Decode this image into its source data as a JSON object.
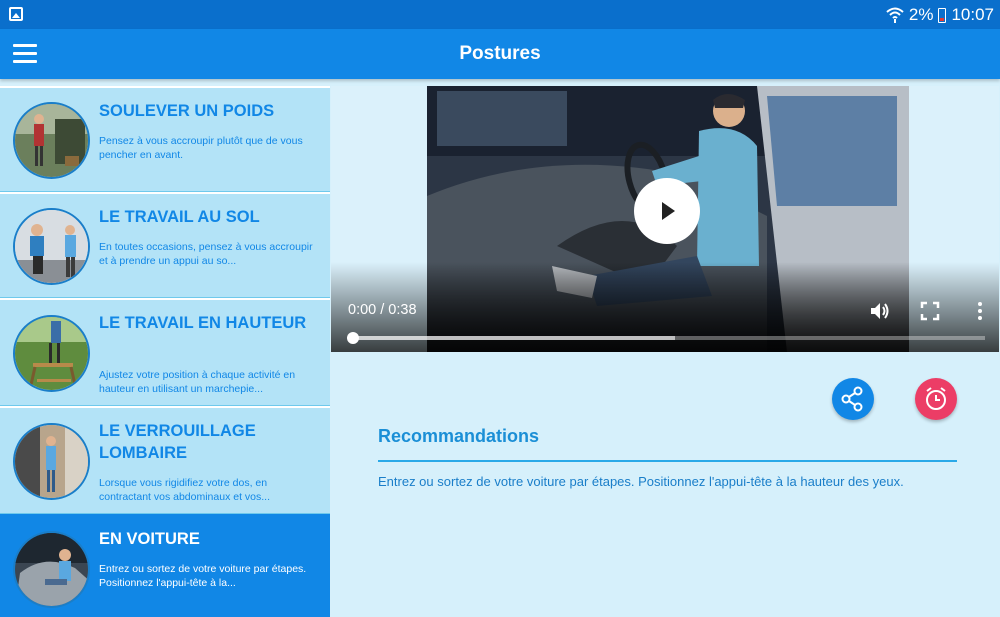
{
  "status_bar": {
    "battery_text": "2%",
    "time": "10:07",
    "icons": [
      "gallery-icon",
      "wifi-icon",
      "battery-icon"
    ]
  },
  "app_bar": {
    "title": "Postures",
    "menu_icon": "hamburger-menu-icon"
  },
  "sidebar": {
    "items": [
      {
        "title": "SOULEVER UN POIDS",
        "desc": "Pensez à vous accroupir plutôt que de vous pencher en avant.",
        "active": false
      },
      {
        "title": "LE TRAVAIL AU SOL",
        "desc": "En toutes occasions, pensez à vous accroupir et à prendre un appui au so...",
        "active": false
      },
      {
        "title": "LE TRAVAIL EN HAUTEUR",
        "desc": "Ajustez votre position à chaque activité en hauteur en utilisant un marchepie...",
        "active": false
      },
      {
        "title": "LE VERROUILLAGE LOMBAIRE",
        "desc": "Lorsque vous rigidifiez votre dos, en contractant vos abdominaux et vos...",
        "active": false
      },
      {
        "title": "EN VOITURE",
        "desc": "Entrez ou sortez de votre voiture par étapes. Positionnez l'appui-tête à la...",
        "active": true
      }
    ]
  },
  "video": {
    "time_display": "0:00 / 0:38",
    "progress": 0,
    "buffered": 0.51,
    "controls": [
      "play-icon",
      "volume-icon",
      "fullscreen-icon",
      "more-vert-icon"
    ]
  },
  "actions": {
    "share_icon": "share-icon",
    "alarm_icon": "alarm-clock-icon"
  },
  "recommendations": {
    "title": "Recommandations",
    "text": "Entrez ou sortez de votre voiture par étapes. Positionnez l'appui-tête à la hauteur des yeux."
  },
  "colors": {
    "app_bar": "#1187e6",
    "status_bar": "#0a6fcc",
    "card_bg": "#b3e3f7",
    "card_active": "#1187e6",
    "content_bg": "#d6f0fb",
    "share": "#1187e6",
    "alarm": "#ec3d66"
  }
}
